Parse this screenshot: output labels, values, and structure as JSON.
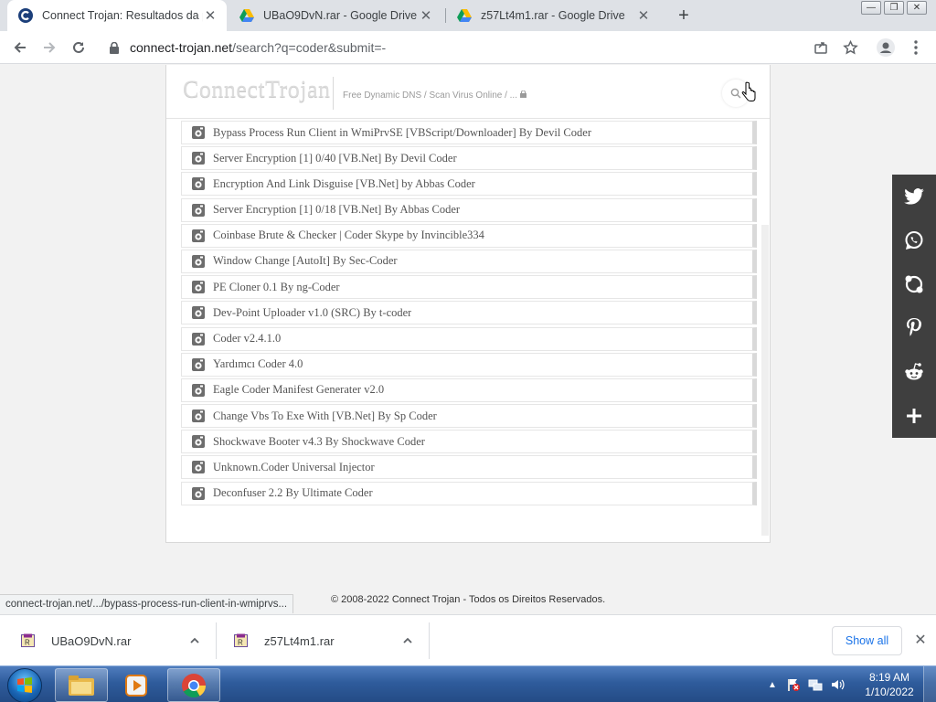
{
  "browser": {
    "tabs": [
      {
        "title": "Connect Trojan: Resultados da pe",
        "active": true
      },
      {
        "title": "UBaO9DvN.rar - Google Drive",
        "active": false
      },
      {
        "title": "z57Lt4m1.rar - Google Drive",
        "active": false
      }
    ],
    "url_host": "connect-trojan.net",
    "url_rest": "/search?q=coder&submit=-"
  },
  "site": {
    "logo": "ConnectTrojan",
    "tagline": "Free Dynamic DNS / Scan Virus Online / ...",
    "results": [
      "Bypass Process Run Client in WmiPrvSE [VBScript/Downloader] By Devil Coder",
      "Server Encryption [1] 0/40 [VB.Net] By Devil Coder",
      "Encryption And Link Disguise [VB.Net] by Abbas Coder",
      "Server Encryption [1] 0/18 [VB.Net] By Abbas Coder",
      "Coinbase Brute & Checker | Coder Skype by Invincible334",
      "Window Change [AutoIt] By Sec-Coder",
      "PE Cloner 0.1 By ng-Coder",
      "Dev-Point Uploader v1.0 (SRC) By t-coder",
      "Coder v2.4.1.0",
      "Yardımcı Coder 4.0",
      "Eagle Coder Manifest Generater v2.0",
      "Change Vbs To Exe With [VB.Net] By Sp Coder",
      "Shockwave Booter v4.3 By Shockwave Coder",
      "Unknown.Coder Universal Injector",
      "Deconfuser 2.2 By Ultimate Coder"
    ],
    "footer": "© 2008-2022 Connect Trojan - Todos os Direitos Reservados."
  },
  "status_url": "connect-trojan.net/.../bypass-process-run-client-in-wmiprvs...",
  "share": {
    "icons": [
      "twitter-icon",
      "whatsapp-icon",
      "skype-icon",
      "pinterest-icon",
      "reddit-icon",
      "plus-icon"
    ],
    "color": "#3f3f3f"
  },
  "downloads": {
    "items": [
      "UBaO9DvN.rar",
      "z57Lt4m1.rar"
    ],
    "show_all": "Show all"
  },
  "taskbar": {
    "time": "8:19 AM",
    "date": "1/10/2022"
  },
  "colors": {
    "accent": "#1a73e8",
    "page_bg": "#f2f2f2"
  }
}
